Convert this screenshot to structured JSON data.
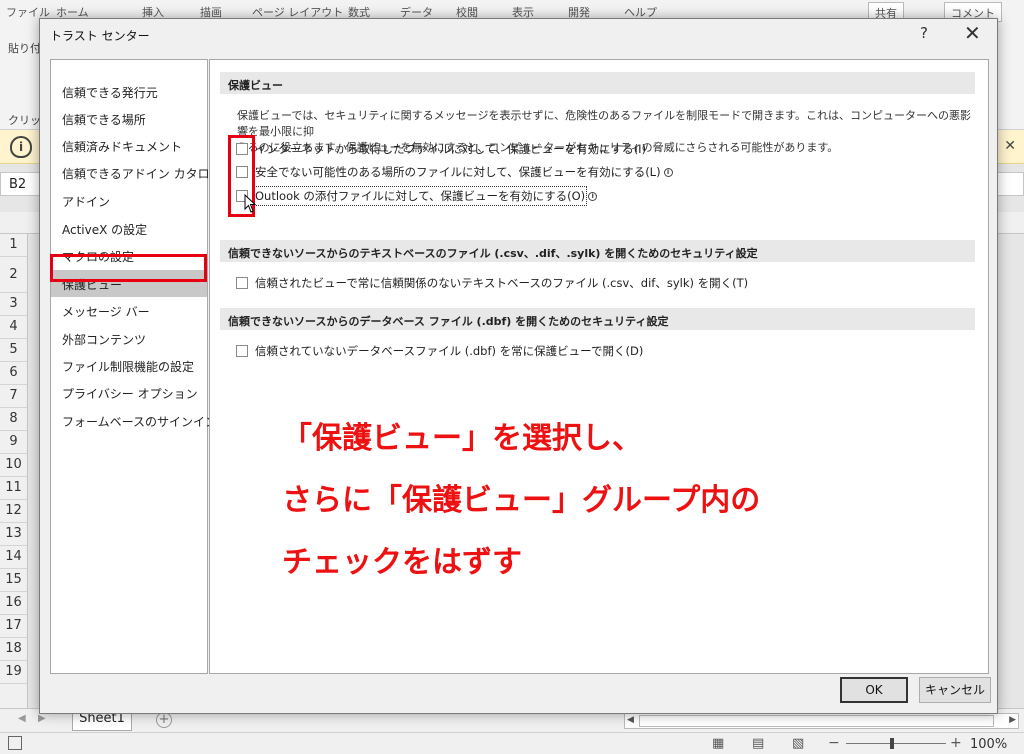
{
  "excel": {
    "tabs": [
      "ファイル",
      "ホーム",
      "挿入",
      "描画",
      "ページ レイアウト",
      "数式",
      "データ",
      "校閲",
      "表示",
      "開発",
      "ヘルプ"
    ],
    "share_btn": "共有",
    "comment_btn": "コメント",
    "paste_label": "貼り付",
    "clipboard_label": "クリッ",
    "name_box": "B2",
    "rows": [
      "1",
      "2",
      "3",
      "4",
      "5",
      "6",
      "7",
      "8",
      "9",
      "10",
      "11",
      "12",
      "13",
      "14",
      "15",
      "16",
      "17",
      "18",
      "19"
    ],
    "sheet_tab": "Sheet1",
    "zoom": "100%"
  },
  "dialog": {
    "title": "トラスト センター",
    "help": "?",
    "close": "✕",
    "nav": [
      "信頼できる発行元",
      "信頼できる場所",
      "信頼済みドキュメント",
      "信頼できるアドイン カタログ",
      "アドイン",
      "ActiveX の設定",
      "マクロの設定",
      "保護ビュー",
      "メッセージ バー",
      "外部コンテンツ",
      "ファイル制限機能の設定",
      "プライバシー オプション",
      "フォームベースのサインイン"
    ],
    "selected_nav": "保護ビュー",
    "section1": {
      "header": "保護ビュー",
      "desc_line1": "保護ビューでは、セキュリティに関するメッセージを表示せずに、危険性のあるファイルを制限モードで開きます。これは、コンピューターへの悪影響を最小限に抑",
      "desc_line2": "えるのに役立ちます。保護ビューを無効にすると、コンピューターがセキュリティの脅威にさらされる可能性があります。",
      "cb1": "インターネットから取得したファイルに対して、保護ビューを有効にする(I)",
      "cb2": "安全でない可能性のある場所のファイルに対して、保護ビューを有効にする(L)",
      "cb3": "Outlook の添付ファイルに対して、保護ビューを有効にする(O)"
    },
    "section2": {
      "header": "信頼できないソースからのテキストベースのファイル (.csv、.dif、.sylk) を開くためのセキュリティ設定",
      "cb": "信頼されたビューで常に信頼関係のないテキストベースのファイル (.csv、dif、sylk) を開く(T)"
    },
    "section3": {
      "header": "信頼できないソースからのデータベース ファイル (.dbf) を開くためのセキュリティ設定",
      "cb": "信頼されていないデータベースファイル (.dbf) を常に保護ビューで開く(D)"
    },
    "annotation": {
      "line1": "「保護ビュー」を選択し、",
      "line2": "さらに「保護ビュー」グループ内の",
      "line3": "チェックをはずす"
    },
    "ok": "OK",
    "cancel": "キャンセル",
    "info_glyph": "i"
  }
}
